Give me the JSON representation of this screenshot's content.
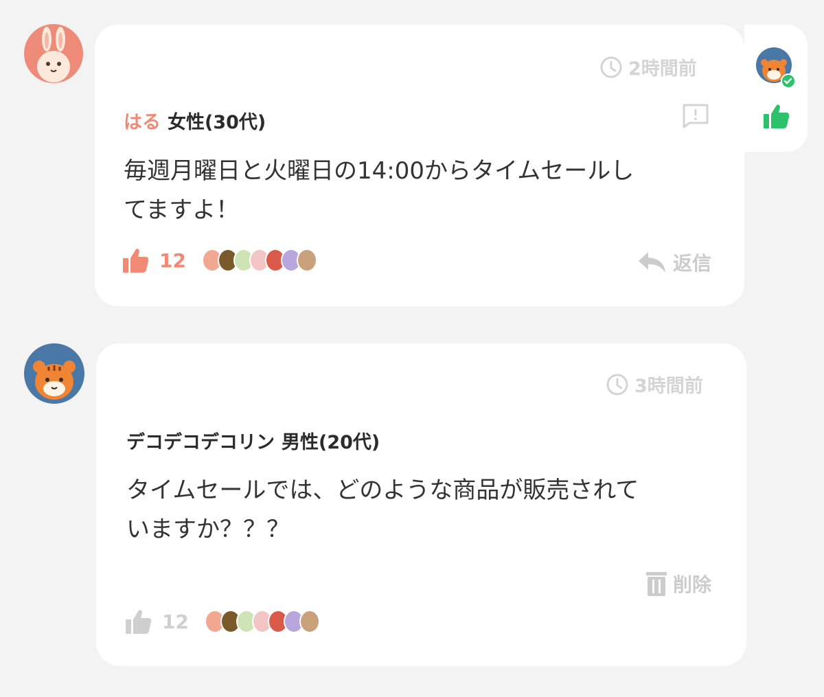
{
  "comments": [
    {
      "time": "2時間前",
      "user_name": "はる",
      "user_meta": "女性(30代)",
      "text_line1": "毎週月曜日と火曜日の14:00からタイムセールし",
      "text_line2": "てますよ！",
      "likes": "12",
      "action_label": "返信",
      "avatar_icon": "rabbit-avatar-icon"
    },
    {
      "time": "3時間前",
      "user_name": "デコデコデコリン",
      "user_meta": "男性(20代)",
      "text_line1": "タイムセールでは、どのような商品が販売されて",
      "text_line2": "いますか？？？",
      "likes": "12",
      "action_label": "削除",
      "avatar_icon": "tiger-avatar-icon"
    }
  ],
  "colors": {
    "accent": "#f08a75",
    "like_active": "#f08a75",
    "like_inactive": "#cfcfcf",
    "green": "#2cc26b",
    "muted": "#d4d4d4",
    "background": "#f3f3f3"
  },
  "icons": [
    "clock-icon",
    "report-flag-icon",
    "thumbs-up-icon",
    "reply-arrow-icon",
    "trash-icon",
    "check-badge-icon"
  ]
}
